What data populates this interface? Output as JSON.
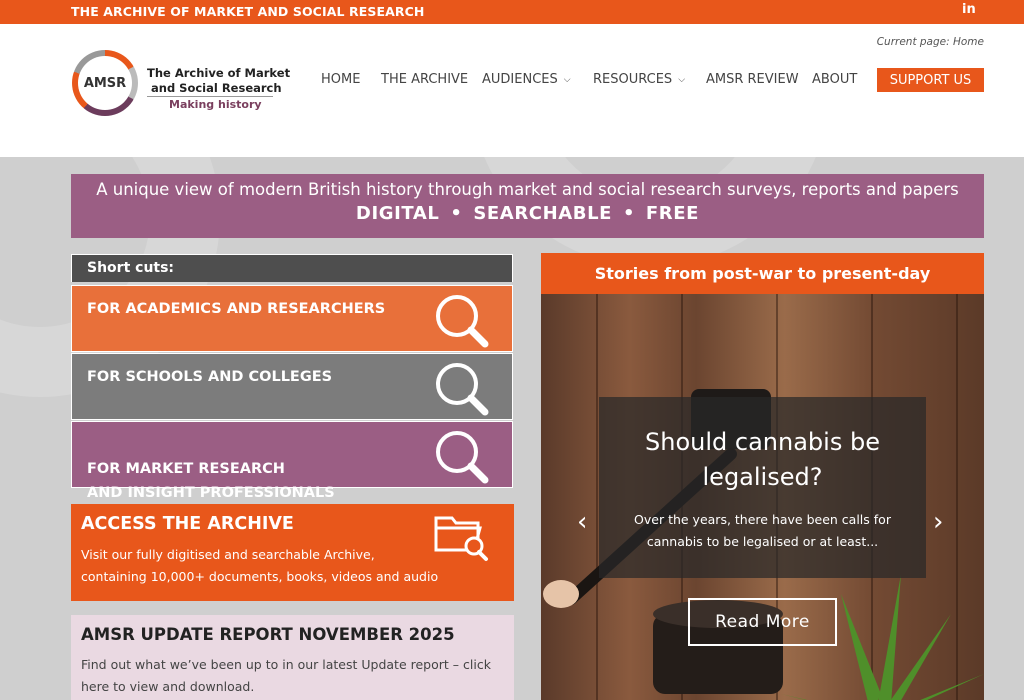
{
  "topbar": {
    "tagline": "THE ARCHIVE OF MARKET AND SOCIAL RESEARCH",
    "linkedin_label": "in"
  },
  "header": {
    "current_page": "Current page: Home",
    "logo": {
      "mark": "AMSR",
      "line1": "The Archive of Market",
      "line2": "and Social Research",
      "tagline": "Making history"
    },
    "nav": [
      {
        "label": "HOME"
      },
      {
        "label": "THE ARCHIVE"
      },
      {
        "label": "AUDIENCES"
      },
      {
        "label": "RESOURCES"
      },
      {
        "label": "AMSR REVIEW"
      },
      {
        "label": "ABOUT"
      }
    ],
    "support_label": "SUPPORT US"
  },
  "banner": {
    "line1": "A unique view of modern British history through market and social research surveys, reports and papers",
    "line2": "DIGITAL  •  SEARCHABLE  •  FREE"
  },
  "shortcuts": {
    "heading": "Short cuts:",
    "items": [
      {
        "label": "FOR ACADEMICS AND RESEARCHERS",
        "color": "#e8703a"
      },
      {
        "label": "FOR SCHOOLS AND COLLEGES",
        "color": "#7c7c7c"
      },
      {
        "label": "FOR MARKET RESEARCH\nAND INSIGHT PROFESSIONALS",
        "color": "#9b5e84"
      }
    ]
  },
  "access": {
    "heading": "ACCESS THE ARCHIVE",
    "line1": "Visit our fully digitised and searchable Archive,",
    "line2": "containing 10,000+ documents, books, videos and audio"
  },
  "update": {
    "heading": "AMSR UPDATE REPORT NOVEMBER 2025",
    "line1": "Find out what we’ve been up to in our latest Update report – click",
    "line2": "here to view and download."
  },
  "stories": {
    "heading": "Stories from post-war to present-day",
    "slide": {
      "title_line1": "Should cannabis be",
      "title_line2": "legalised?",
      "excerpt_line1": "Over the years, there have been calls for",
      "excerpt_line2": "cannabis to be legalised or at least...",
      "button": "Read More"
    },
    "prev_arrow": "‹",
    "next_arrow": "›"
  },
  "colors": {
    "brand_orange": "#e8571b",
    "brand_plum": "#9b5e84",
    "panel_gray": "#cfcfcf"
  }
}
